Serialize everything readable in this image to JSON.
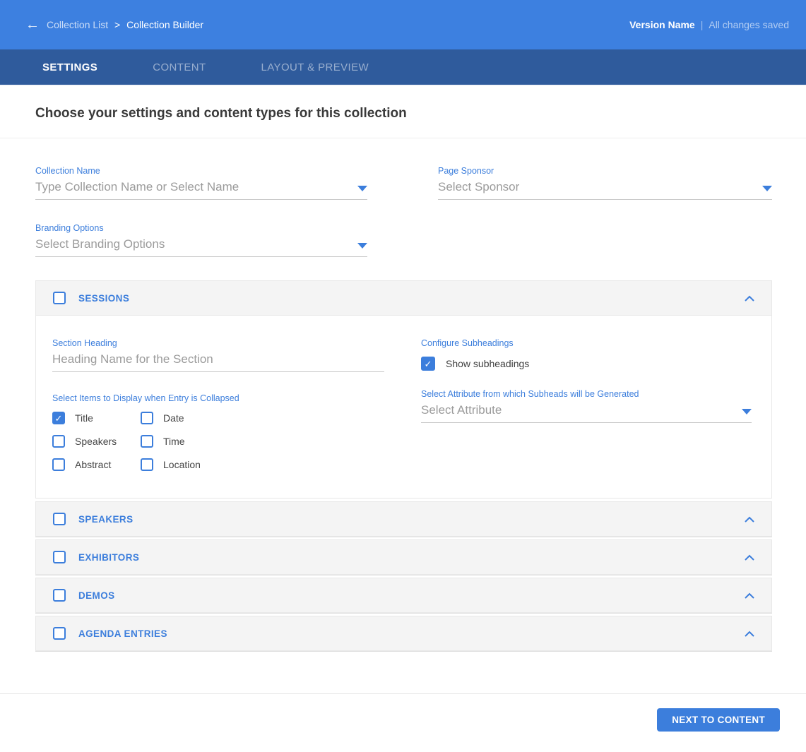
{
  "topbar": {
    "breadcrumb": {
      "parent": "Collection List",
      "separator": ">",
      "current": "Collection Builder"
    },
    "version_label": "Version Name",
    "separator": "|",
    "status": "All changes saved"
  },
  "tabs": [
    {
      "label": "SETTINGS",
      "active": true
    },
    {
      "label": "CONTENT",
      "active": false
    },
    {
      "label": "LAYOUT & PREVIEW",
      "active": false
    }
  ],
  "page": {
    "title": "Choose your settings and content types for this collection"
  },
  "form": {
    "collection_name": {
      "label": "Collection Name",
      "placeholder": "Type Collection Name or Select Name"
    },
    "page_sponsor": {
      "label": "Page Sponsor",
      "placeholder": "Select Sponsor"
    },
    "branding_options": {
      "label": "Branding Options",
      "placeholder": "Select Branding Options"
    }
  },
  "sections": {
    "sessions": {
      "title": "SESSIONS",
      "checked": false,
      "expanded": true,
      "section_heading": {
        "label": "Section Heading",
        "placeholder": "Heading Name for the Section"
      },
      "configure_subheadings": {
        "label": "Configure Subheadings",
        "checkbox_label": "Show subheadings",
        "checked": true
      },
      "collapsed_items": {
        "label": "Select Items to Display when Entry is Collapsed",
        "options": [
          {
            "label": "Title",
            "checked": true
          },
          {
            "label": "Date",
            "checked": false
          },
          {
            "label": "Speakers",
            "checked": false
          },
          {
            "label": "Time",
            "checked": false
          },
          {
            "label": "Abstract",
            "checked": false
          },
          {
            "label": "Location",
            "checked": false
          }
        ]
      },
      "subhead_attribute": {
        "label": "Select Attribute from which Subheads will be Generated",
        "placeholder": "Select Attribute"
      }
    },
    "collapsed": [
      {
        "title": "SPEAKERS",
        "checked": false
      },
      {
        "title": "EXHIBITORS",
        "checked": false
      },
      {
        "title": "DEMOS",
        "checked": false
      },
      {
        "title": "AGENDA ENTRIES",
        "checked": false
      }
    ]
  },
  "footer": {
    "next_button": "NEXT TO CONTENT"
  },
  "icons": {
    "back_arrow": "←",
    "checkmark": "✓"
  },
  "colors": {
    "topbar_bg": "#3d80e0",
    "tabbar_bg": "#2f5b9c",
    "accent": "#3c7edc",
    "placeholder_text": "#9b9b9b",
    "heading_text": "#3a3a3a",
    "panel_bg": "#f4f4f4",
    "panel_border": "#e8e8e8",
    "underline": "#c9c9c9"
  }
}
